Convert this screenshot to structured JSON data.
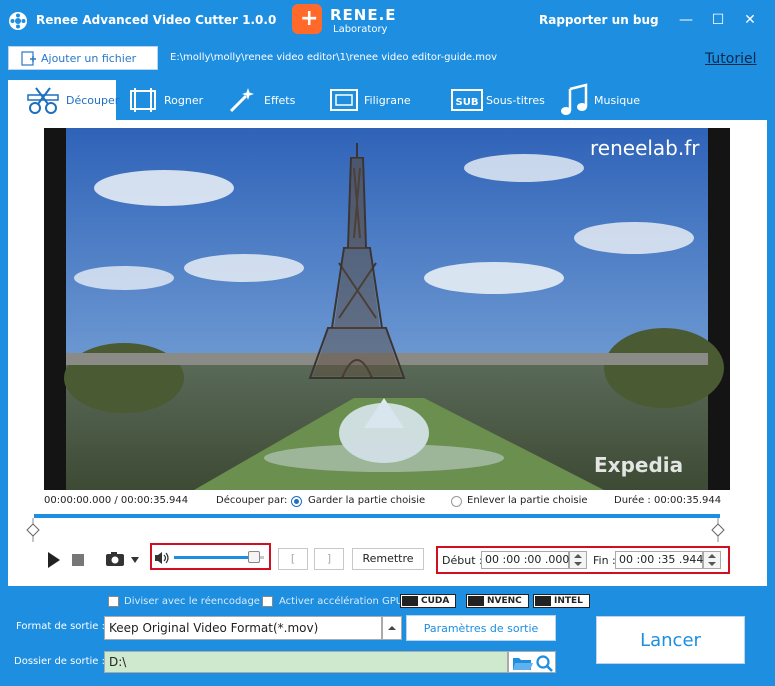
{
  "app": {
    "title": "Renee Advanced Video Cutter 1.0.0",
    "logo_name": "RENE.E",
    "logo_sub": "Laboratory",
    "report_bug": "Rapporter un bug",
    "minimize": "—",
    "maximize": "☐",
    "close": "✕"
  },
  "file": {
    "add_label": "Ajouter un fichier",
    "path": "E:\\molly\\molly\\renee video editor\\1\\renee video editor-guide.mov",
    "tutorial": "Tutoriel"
  },
  "tabs": [
    {
      "label": "Découper",
      "icon": "scissors-film-icon",
      "active": true
    },
    {
      "label": "Rogner",
      "icon": "crop-film-icon",
      "active": false
    },
    {
      "label": "Effets",
      "icon": "magic-wand-icon",
      "active": false
    },
    {
      "label": "Filigrane",
      "icon": "watermark-icon",
      "active": false
    },
    {
      "label": "Sous-titres",
      "icon": "subtitle-icon",
      "active": false
    },
    {
      "label": "Musique",
      "icon": "music-note-icon",
      "active": false
    }
  ],
  "video": {
    "watermark_top": "reneelab.fr",
    "watermark_bottom": "Expedia"
  },
  "timeline": {
    "current_total": "00:00:00.000 / 00:00:35.944",
    "cut_by_label": "Découper par:",
    "option_keep": "Garder la partie choisie",
    "option_remove": "Enlever la partie choisie",
    "duration": "Durée : 00:00:35.944",
    "volume_level": 0.95
  },
  "controls": {
    "mark_in": "[",
    "mark_out": "]",
    "reset": "Remettre",
    "start_label": "Début :",
    "start_value": "00 :00 :00 .000",
    "end_label": "Fin :",
    "end_value": "00 :00 :35 .944"
  },
  "options": {
    "split_reencode": "Diviser avec le réencodage",
    "gpu_accel": "Activer accélération GPU",
    "badges": [
      "CUDA",
      "NVENC",
      "INTEL"
    ]
  },
  "output": {
    "format_label": "Format de sortie :",
    "format_value": "Keep Original Video Format(*.mov)",
    "params_button": "Paramètres de sortie",
    "folder_label": "Dossier de sortie :",
    "folder_value": "D:\\",
    "launch": "Lancer"
  },
  "colors": {
    "brand_blue": "#1d8ee0",
    "highlight_red": "#d01020",
    "folder_bg": "#cfe9cf"
  }
}
